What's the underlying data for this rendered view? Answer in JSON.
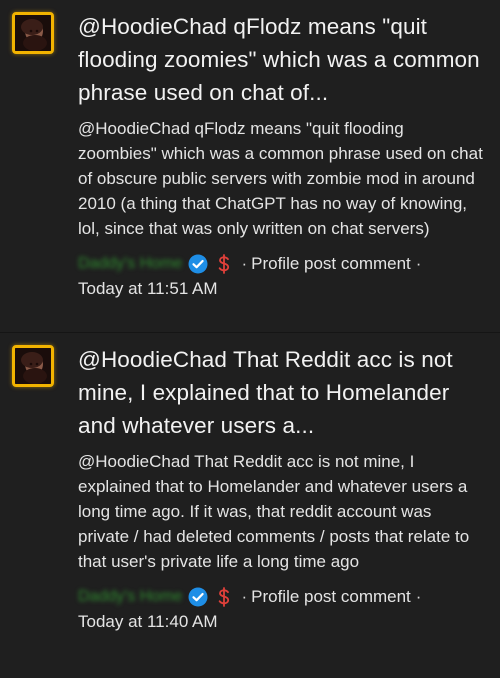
{
  "notifications": [
    {
      "title": "@HoodieChad qFlodz means \"quit flooding zoomies\" which was a common phrase used on chat of...",
      "body": "@HoodieChad qFlodz means \"quit flooding zoombies\" which was a common phrase used on chat of obscure public servers with zombie mod in around 2010 (a thing that ChatGPT has no way of knowing, lol, since that was only written on chat servers)",
      "author": "Daddy's Home",
      "separator": "·",
      "post_type": "Profile post comment",
      "time": "Today at 11:51 AM"
    },
    {
      "title": "@HoodieChad That Reddit acc is not mine, I explained that to Homelander and whatever users a...",
      "body": "@HoodieChad That Reddit acc is not mine, I explained that to Homelander and whatever users a long time ago. If it was, that reddit account was private / had deleted comments / posts that relate to that user's private life a long time ago",
      "author": "Daddy's Home",
      "separator": "·",
      "post_type": "Profile post comment",
      "time": "Today at 11:40 AM"
    }
  ],
  "icons": {
    "verified": "verified-badge-icon",
    "dollar": "dollar-icon"
  },
  "colors": {
    "background": "#1f1f1f",
    "avatar_border": "#f2b300",
    "author": "#2f8a2f",
    "verified": "#1e8ee6",
    "dollar": "#e0403a"
  }
}
